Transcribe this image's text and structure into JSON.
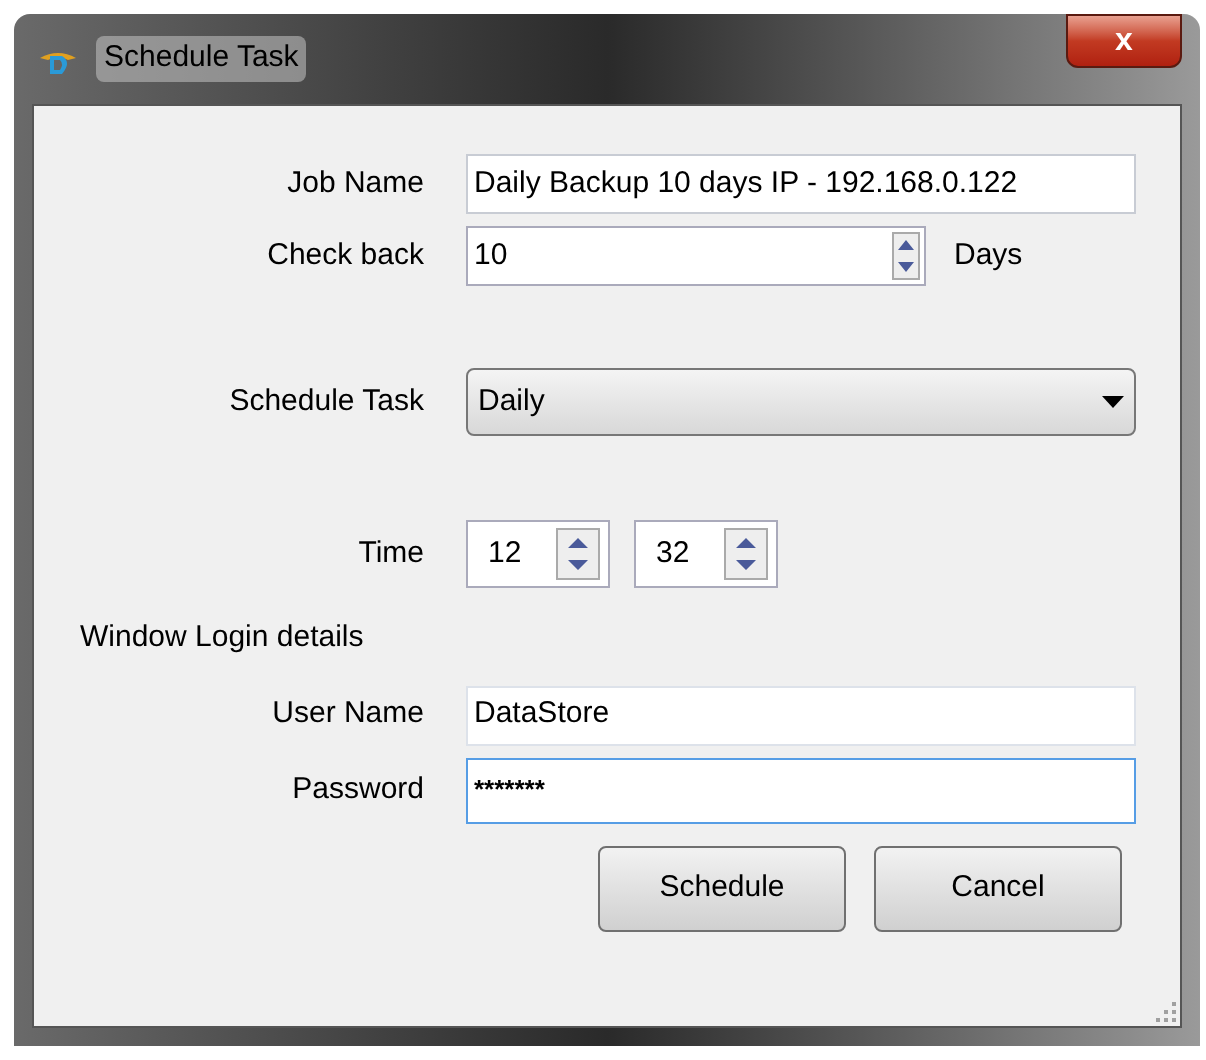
{
  "window": {
    "title": "Schedule Task",
    "close": "x"
  },
  "job_name": {
    "label": "Job Name",
    "value": "Daily Backup 10 days IP - 192.168.0.122"
  },
  "check_back": {
    "label": "Check back",
    "value": "10",
    "unit": "Days"
  },
  "schedule": {
    "label": "Schedule Task",
    "value": "Daily"
  },
  "time": {
    "label": "Time",
    "hour": "12",
    "minute": "32"
  },
  "login_heading": "Window Login details",
  "user_name": {
    "label": "User Name",
    "value": "DataStore",
    "focused": false
  },
  "password": {
    "label": "Password",
    "value": "*******",
    "focused": true
  },
  "buttons": [
    "Schedule",
    "Cancel"
  ]
}
